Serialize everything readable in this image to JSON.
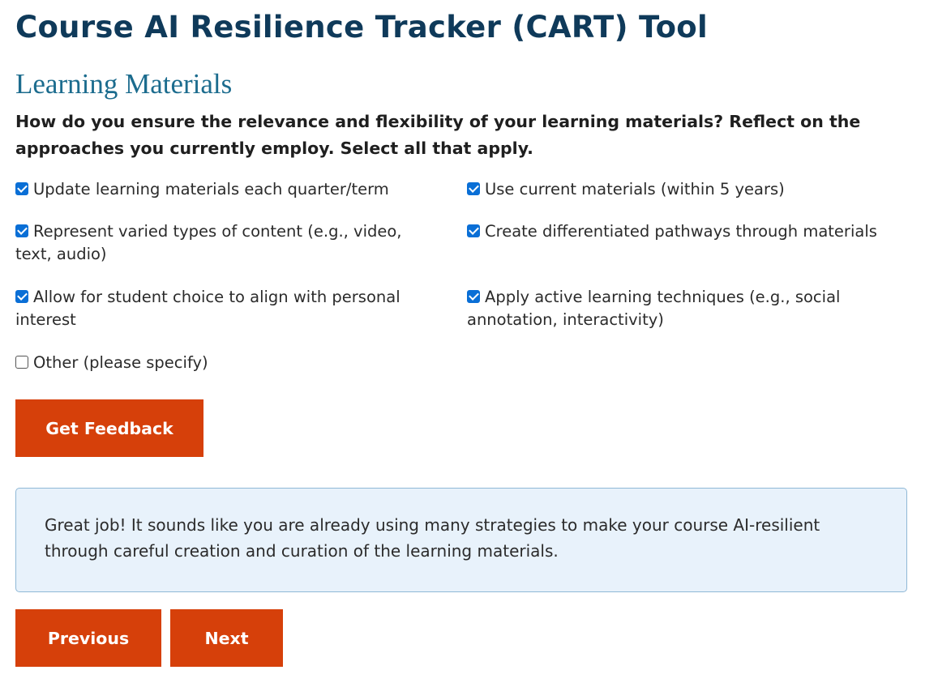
{
  "header": {
    "title": "Course AI Resilience Tracker (CART) Tool"
  },
  "section": {
    "title": "Learning Materials",
    "question": "How do you ensure the relevance and flexibility of your learning materials? Reflect on the approaches you currently employ. Select all that apply."
  },
  "options": [
    {
      "label": "Update learning materials each quarter/term",
      "checked": true
    },
    {
      "label": "Use current materials (within 5 years)",
      "checked": true
    },
    {
      "label": "Represent varied types of content (e.g., video, text, audio)",
      "checked": true
    },
    {
      "label": "Create differentiated pathways through materials",
      "checked": true
    },
    {
      "label": "Allow for student choice to align with personal interest",
      "checked": true
    },
    {
      "label": "Apply active learning techniques (e.g., social annotation, interactivity)",
      "checked": true
    },
    {
      "label": "Other (please specify)",
      "checked": false
    }
  ],
  "buttons": {
    "feedback_label": "Get Feedback",
    "previous_label": "Previous",
    "next_label": "Next"
  },
  "feedback": {
    "message": "Great job! It sounds like you are already using many strategies to make your course AI-resilient through careful creation and curation of the learning materials."
  },
  "colors": {
    "title": "#0f3a5a",
    "section_title": "#1c6c8e",
    "button": "#d6400a",
    "checkbox": "#0a6fd6",
    "feedback_bg": "#e8f2fb",
    "feedback_border": "#8fb8d6"
  }
}
